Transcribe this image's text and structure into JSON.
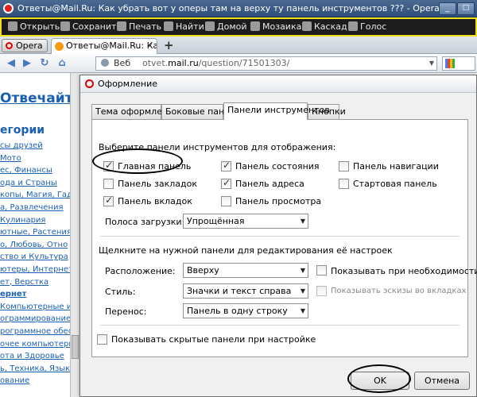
{
  "window": {
    "title": "Ответы@Mail.Ru: Как убрать вот у оперы там на верху ту панель инструментов ??? - Opera",
    "minimize": "_",
    "maximize": "□"
  },
  "main_toolbar": {
    "items": [
      "Открыть",
      "Сохранить",
      "Печать",
      "Найти",
      "Домой",
      "Мозаика",
      "Каскад",
      "Голос"
    ]
  },
  "tabbar": {
    "opera_menu": "Opera",
    "tab_title": "Ответы@Mail.Ru: Как ...",
    "close": "×",
    "new_tab": "+"
  },
  "address_bar": {
    "web_label": "Веб",
    "url_prefix": "otvet.",
    "url_domain": "mail.ru",
    "url_path": "/question/71501303/"
  },
  "page": {
    "otvechayte": "Отвечайте!",
    "categories_title": "егории",
    "categories": [
      "сы друзей",
      "Мото",
      "ес, Финансы",
      "ода и Страны",
      "копы, Магия, Гадани",
      "а, Развлечения",
      "Кулинария",
      "ютные, Растения",
      "о, Любовь, Отно",
      "ство и Культура",
      "ютеры, Интернет",
      "ет, Верстка",
      "ернет",
      "Компьютерные и Виде",
      "ограммирование",
      "рограммное обеспече",
      "очее компьютерное",
      "ота и Здоровье",
      "ь, Техника, Языки",
      "ование"
    ]
  },
  "dialog": {
    "title": "Оформление",
    "tabs": [
      "Тема оформления",
      "Боковые панели",
      "Панели инструментов",
      "Кнопки"
    ],
    "active_tab": "Панели инструментов",
    "section1_heading": "Выберите панели инструментов для отображения:",
    "checkboxes": [
      {
        "label": "Главная панель",
        "checked": true
      },
      {
        "label": "Панель состояния",
        "checked": true
      },
      {
        "label": "Панель навигации",
        "checked": false
      },
      {
        "label": "Панель закладок",
        "checked": false
      },
      {
        "label": "Панель адреса",
        "checked": true
      },
      {
        "label": "Стартовая панель",
        "checked": false
      },
      {
        "label": "Панель вкладок",
        "checked": true
      },
      {
        "label": "Панель просмотра",
        "checked": false
      }
    ],
    "download_bar_label": "Полоса загрузки:",
    "download_bar_value": "Упрощённая",
    "section2_heading": "Щелкните на нужной панели для редактирования её настроек",
    "placement_label": "Расположение:",
    "placement_value": "Вверху",
    "show_when_needed": "Показывать при необходимости",
    "style_label": "Стиль:",
    "style_value": "Значки и текст справа",
    "show_thumbnails": "Показывать эскизы во вкладках",
    "wrap_label": "Перенос:",
    "wrap_value": "Панель в одну строку",
    "show_hidden": "Показывать скрытые панели при настройке",
    "ok": "OK",
    "cancel": "Отмена"
  }
}
